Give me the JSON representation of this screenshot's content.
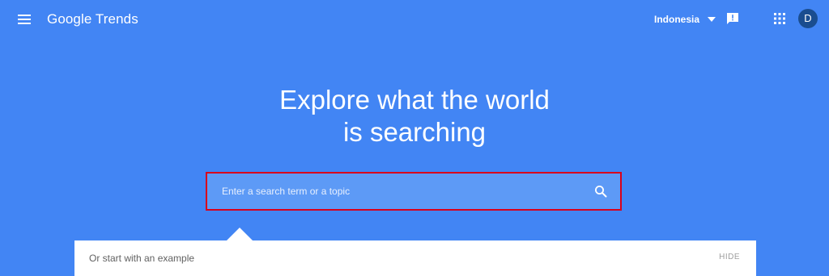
{
  "header": {
    "brand": "Google Trends",
    "country": "Indonesia",
    "avatar_initial": "D",
    "icons": {
      "menu": "menu-icon",
      "feedback": "feedback-icon",
      "apps": "apps-icon",
      "dropdown": "chevron-down-icon"
    }
  },
  "hero": {
    "title_line1": "Explore what the world",
    "title_line2": "is searching"
  },
  "search": {
    "placeholder": "Enter a search term or a topic",
    "value": "",
    "icon": "search-icon"
  },
  "examples": {
    "label": "Or start with an example",
    "hide_label": "HIDE"
  },
  "colors": {
    "background": "#4285f4",
    "search_field": "#5d9af6",
    "highlight_border": "#d9001b",
    "avatar": "#1a4d8f",
    "panel": "#ffffff"
  }
}
